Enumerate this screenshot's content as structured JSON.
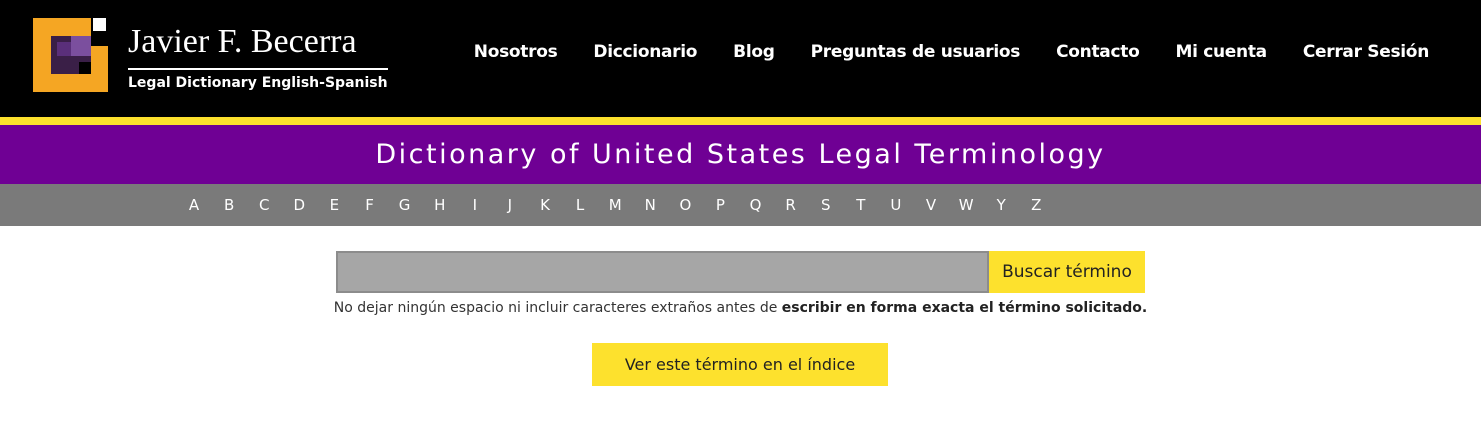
{
  "header": {
    "brand_name": "Javier F. Becerra",
    "brand_subtitle": "Legal Dictionary English-Spanish",
    "logo_icon": "square-bracket-logo-icon",
    "nav": [
      {
        "label": "Nosotros"
      },
      {
        "label": "Diccionario"
      },
      {
        "label": "Blog"
      },
      {
        "label": "Preguntas de usuarios"
      },
      {
        "label": "Contacto"
      },
      {
        "label": "Mi cuenta"
      },
      {
        "label": "Cerrar Sesión"
      }
    ]
  },
  "title_band": {
    "title": "Dictionary of United States Legal Terminology"
  },
  "alphabet": [
    "A",
    "B",
    "C",
    "D",
    "E",
    "F",
    "G",
    "H",
    "I",
    "J",
    "K",
    "L",
    "M",
    "N",
    "O",
    "P",
    "Q",
    "R",
    "S",
    "T",
    "U",
    "V",
    "W",
    "Y",
    "Z"
  ],
  "search": {
    "value": "",
    "placeholder": "",
    "button_label": "Buscar término",
    "hint_normal": "No dejar ningún espacio ni incluir caracteres extraños antes de ",
    "hint_bold": "escribir en forma exacta el término solicitado."
  },
  "index_button_label": "Ver este término en el índice",
  "colors": {
    "header_bg": "#000000",
    "accent_yellow": "#fde12d",
    "title_purple": "#6f0094",
    "alpha_gray": "#7a7a7a"
  }
}
